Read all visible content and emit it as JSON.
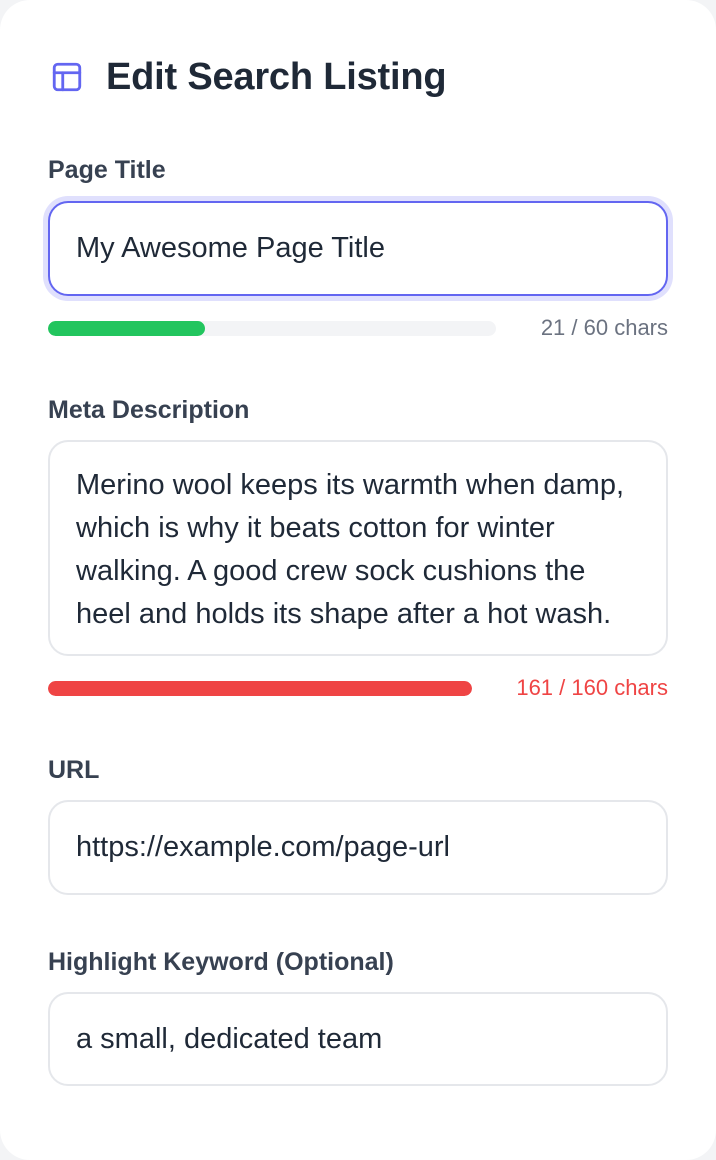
{
  "header": {
    "title": "Edit Search Listing",
    "icon": "layout-icon",
    "icon_color": "#6366f1"
  },
  "fields": {
    "page_title": {
      "label": "Page Title",
      "value": "My Awesome Page Title",
      "count_text": "21 / 60 chars",
      "progress": 0.35,
      "bar_color": "#22c55e"
    },
    "meta_description": {
      "label": "Meta Description",
      "value": "Merino wool keeps its warmth when damp, which is why it beats cotton for winter walking. A good crew sock cushions the heel and holds its shape after a hot wash.",
      "count_text": "161 / 160 chars",
      "progress": 1.0,
      "bar_color": "#ef4444"
    },
    "url": {
      "label": "URL",
      "value": "https://example.com/page-url"
    },
    "highlight_keyword": {
      "label": "Highlight Keyword (Optional)",
      "value": "a small, dedicated team"
    }
  },
  "colors": {
    "accent": "#6366f1",
    "ok": "#22c55e",
    "over_limit": "#ef4444"
  }
}
